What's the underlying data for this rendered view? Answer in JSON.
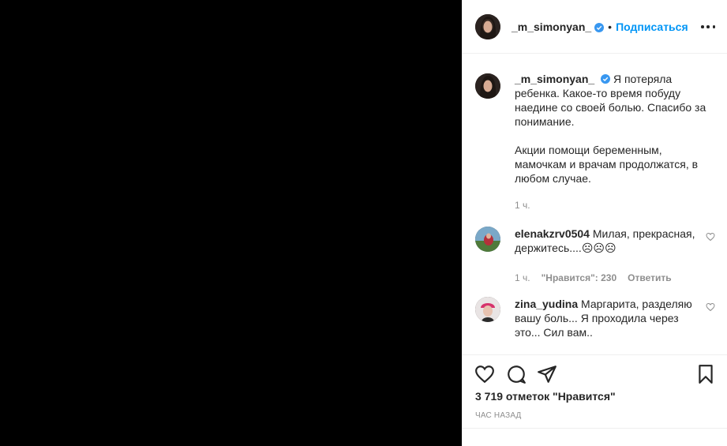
{
  "post": {
    "author": "_m_simonyan_",
    "follow_label": "Подписаться",
    "separator": "•",
    "caption_line1": "Я потеряла ребенка. Какое-то время побуду наедине со своей болью. Спасибо за понимание.",
    "caption_line2": "Акции помощи беременным, мамочкам и врачам продолжатся, в любом случае.",
    "caption_time": "1 ч."
  },
  "comments": [
    {
      "user": "elenakzrv0504",
      "text": "Милая, прекрасная, держитесь....☹☹☹",
      "time": "1 ч.",
      "likes": "\"Нравится\": 230",
      "reply_label": "Ответить"
    },
    {
      "user": "zina_yudina",
      "text": "Маргарита, разделяю вашу боль... Я проходила через это... Сил вам.."
    }
  ],
  "footer": {
    "likes_text": "3 719 отметок \"Нравится\"",
    "time_ago": "ЧАС НАЗАД"
  },
  "icons": {
    "verified": "verified-badge-icon",
    "more": "more-options-icon",
    "like": "heart-icon",
    "comment": "comment-bubble-icon",
    "share": "paper-plane-icon",
    "save": "bookmark-icon"
  },
  "colors": {
    "accent": "#0095f6",
    "text": "#262626",
    "muted": "#8e8e8e",
    "divider": "#efefef"
  }
}
